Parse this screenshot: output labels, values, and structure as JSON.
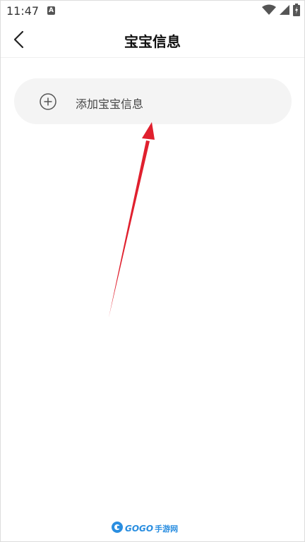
{
  "status_bar": {
    "time": "11:47",
    "notification_icon": "a-icon",
    "icons": [
      "wifi-icon",
      "signal-icon",
      "battery-icon"
    ]
  },
  "header": {
    "title": "宝宝信息",
    "back_icon": "chevron-left-icon"
  },
  "add_card": {
    "label": "添加宝宝信息",
    "icon": "plus-circle-icon"
  },
  "annotation": {
    "color": "#e0202e",
    "icon": "red-arrow"
  },
  "watermark": {
    "brand": "GOGO",
    "suffix": "手游网"
  },
  "colors": {
    "card_background": "#f4f4f4",
    "title": "#111111",
    "arrow": "#e0202e",
    "watermark": "#2a8ee0"
  }
}
